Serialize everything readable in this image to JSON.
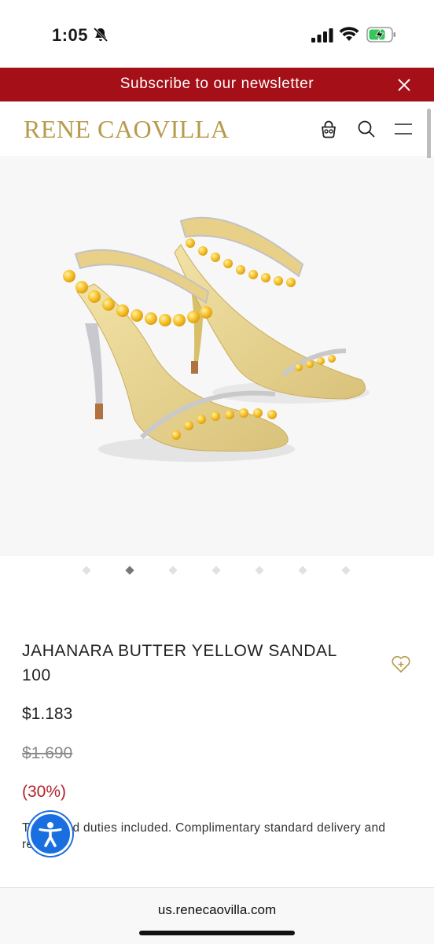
{
  "status_bar": {
    "time": "1:05"
  },
  "newsletter": {
    "text": "Subscribe to our newsletter"
  },
  "header": {
    "brand": "RENE CAOVILLA"
  },
  "gallery": {
    "slide_count": 7,
    "active_index": 1
  },
  "product": {
    "name": "JAHANARA BUTTER YELLOW SANDAL 100",
    "price": "$1.183",
    "original_price": "$1.690",
    "discount": "(30%)",
    "tax_note": "Taxes and duties included. Complimentary standard delivery and returns."
  },
  "browser": {
    "url": "us.renecaovilla.com"
  },
  "colors": {
    "banner": "#a50f17",
    "brand_gold": "#b89a4c",
    "discount_red": "#b3202a",
    "accessibility_blue": "#1a6fe0"
  }
}
